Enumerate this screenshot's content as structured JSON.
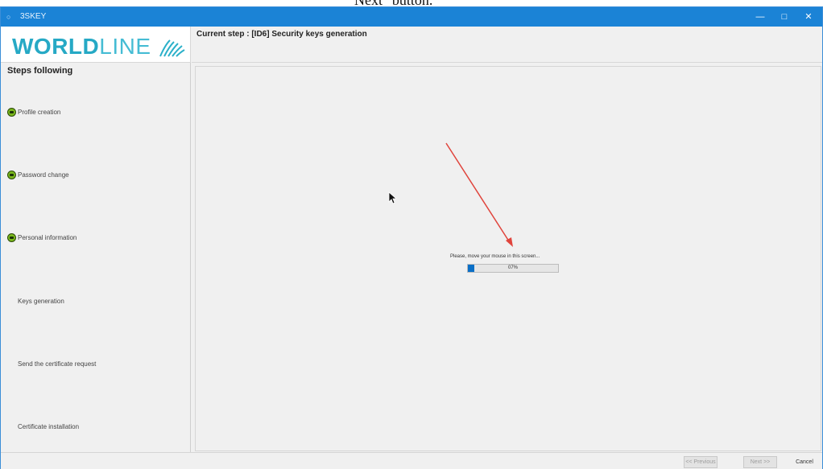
{
  "caption": "Next\" button.",
  "window": {
    "title": "3SKEY",
    "minimize_glyph": "—",
    "maximize_glyph": "□",
    "close_glyph": "✕"
  },
  "logo": {
    "bold": "WORLD",
    "light": "LINE"
  },
  "header": {
    "current_step": "Current step : [ID6] Security keys generation"
  },
  "sidebar": {
    "title": "Steps following",
    "steps": [
      {
        "label": "Profile creation",
        "done": true
      },
      {
        "label": "Password change",
        "done": true
      },
      {
        "label": "Personal information",
        "done": true
      },
      {
        "label": "Keys generation",
        "done": false
      },
      {
        "label": "Send the certificate request",
        "done": false
      },
      {
        "label": "Certificate installation",
        "done": false
      }
    ]
  },
  "main": {
    "message": "Please, move your mouse in this screen...",
    "progress": {
      "value": 0.07,
      "label": "07%"
    }
  },
  "footer": {
    "previous_label": "<< Previous",
    "next_label": "Next >>",
    "cancel_label": "Cancel"
  },
  "colors": {
    "titlebar": "#1b83d6",
    "brand": "#26a9c5",
    "progress_fill": "#0a6fc7",
    "annotation_arrow": "#e0443c",
    "check": "#7ab81c"
  },
  "icons": {
    "app": "app-icon",
    "step_done": "check-circle-icon",
    "cursor": "mouse-pointer-icon"
  }
}
